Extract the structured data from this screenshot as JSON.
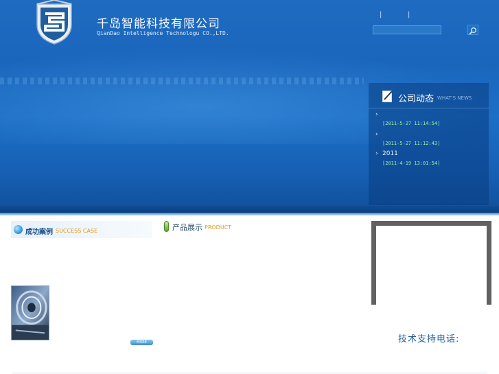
{
  "header": {
    "company_name_cn": "千岛智能科技有限公司",
    "company_name_en": "QianDao Intelligence Technologu CO.,LTD.",
    "top_links": [
      "|",
      "|"
    ],
    "search": {
      "value": "",
      "placeholder": ""
    },
    "colors": {
      "banner": "#1a66bd",
      "banner_dark": "#0f4f99"
    }
  },
  "news": {
    "title": "公司动态",
    "subtitle": "WHAT'S NEWS",
    "items": [
      {
        "arrow": "›",
        "text": "",
        "date": "[2011-5-27 11:14:54]"
      },
      {
        "arrow": "›",
        "text": "",
        "date": "[2011-5-27 11:12:43]"
      },
      {
        "arrow": "›",
        "text": "2011",
        "date": "[2011-4-19 13:01:54]"
      }
    ],
    "date_color": "#9ff0a8"
  },
  "cases": {
    "title": "成功案例",
    "subtitle": "SUCCESS CASE",
    "more_label": "MORE",
    "accent": "#e59a16"
  },
  "products": {
    "title": "产品展示",
    "subtitle": "PRODUCT"
  },
  "support": {
    "label": "技术支持电话:"
  },
  "icons": [
    "shield-logo-icon",
    "search-icon",
    "pencil-note-icon",
    "bullet-dot-icon",
    "capsule-icon",
    "chevron-right-icon"
  ]
}
